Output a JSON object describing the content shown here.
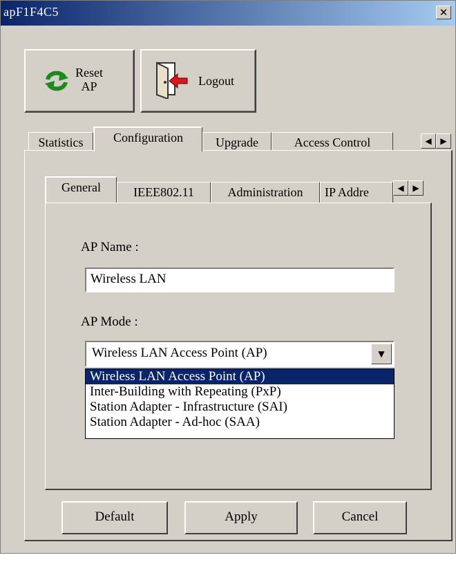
{
  "window": {
    "title": "apF1F4C5"
  },
  "toolbar": {
    "reset_label_line1": "Reset",
    "reset_label_line2": "AP",
    "logout_label": "Logout",
    "reset_icon": "refresh-icon",
    "logout_icon": "door-exit-icon"
  },
  "main_tabs": [
    {
      "label": "Statistics"
    },
    {
      "label": "Configuration",
      "active": true
    },
    {
      "label": "Upgrade"
    },
    {
      "label": "Access Control"
    }
  ],
  "sub_tabs": [
    {
      "label": "General",
      "active": true
    },
    {
      "label": "IEEE802.11"
    },
    {
      "label": "Administration"
    },
    {
      "label": "IP Addre"
    }
  ],
  "form": {
    "ap_name_label": "AP Name :",
    "ap_name_value": "Wireless LAN",
    "ap_mode_label": "AP Mode :",
    "ap_mode_value": "Wireless LAN Access Point (AP)",
    "ap_mode_options": [
      "Wireless LAN Access Point (AP)",
      "Inter-Building with Repeating (PxP)",
      "Station Adapter - Infrastructure (SAI)",
      "Station Adapter - Ad-hoc (SAA)"
    ]
  },
  "buttons": {
    "default_label": "Default",
    "apply_label": "Apply",
    "cancel_label": "Cancel"
  },
  "colors": {
    "titlebar_start": "#0a246a",
    "titlebar_end": "#a6caf0",
    "face": "#d4d0c8",
    "selection": "#0a246a"
  }
}
